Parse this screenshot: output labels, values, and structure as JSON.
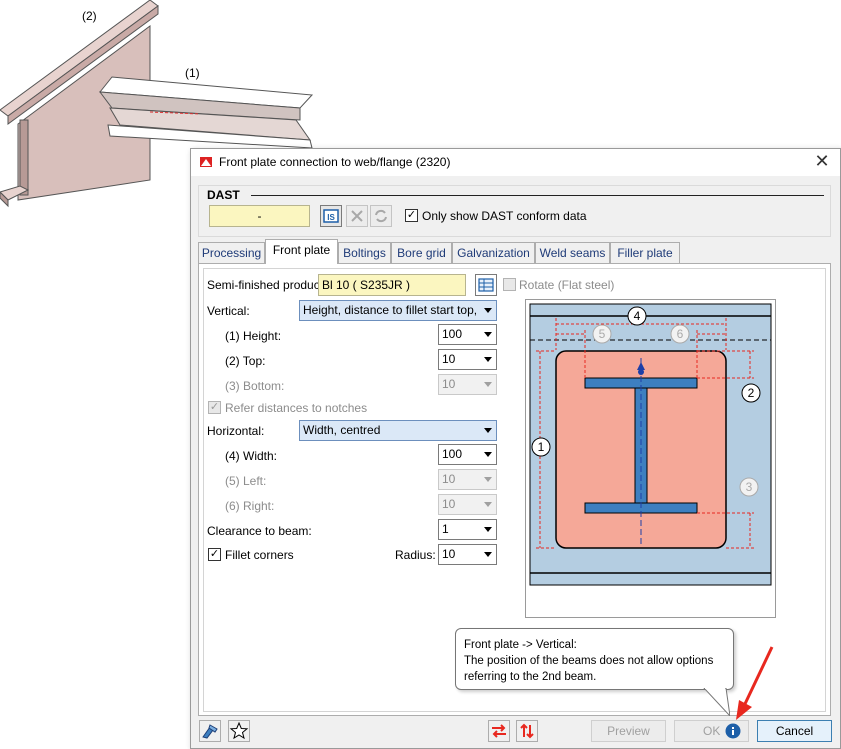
{
  "illustration": {
    "label_beam2": "(2)",
    "label_beam1": "(1)"
  },
  "dialog": {
    "title": "Front plate connection to web/flange (2320)",
    "dast": {
      "group_label": "DAST",
      "field_value": "-",
      "only_conform_label": "Only show DAST conform data",
      "only_conform_checked": true
    },
    "tabs": [
      {
        "label": "Processing",
        "active": false
      },
      {
        "label": "Front plate",
        "active": true
      },
      {
        "label": "Boltings",
        "active": false
      },
      {
        "label": "Bore grid",
        "active": false
      },
      {
        "label": "Galvanization",
        "active": false
      },
      {
        "label": "Weld seams",
        "active": false
      },
      {
        "label": "Filler plate",
        "active": false
      }
    ],
    "form": {
      "semi_finished_label": "Semi-finished produc",
      "semi_finished_value": "Bl 10  ( S235JR )",
      "rotate_label": "Rotate (Flat steel)",
      "vertical_label": "Vertical:",
      "vertical_value": "Height, distance to fillet start top,",
      "height_label": "(1) Height:",
      "height_value": "100",
      "top_label": "(2) Top:",
      "top_value": "10",
      "bottom_label": "(3) Bottom:",
      "bottom_value": "10",
      "refer_notches_label": "Refer distances to notches",
      "horizontal_label": "Horizontal:",
      "horizontal_value": "Width, centred",
      "width_label": "(4) Width:",
      "width_value": "100",
      "left_label": "(5) Left:",
      "left_value": "10",
      "right_label": "(6) Right:",
      "right_value": "10",
      "clearance_label": "Clearance to beam:",
      "clearance_value": "1",
      "fillet_label": "Fillet corners",
      "fillet_checked": true,
      "radius_label": "Radius:",
      "radius_value": "10"
    },
    "diagram_labels": [
      "4",
      "5",
      "6",
      "2",
      "1",
      "3"
    ],
    "tooltip": {
      "line1": "Front plate -> Vertical:",
      "line2": "The position of the beams does not allow options",
      "line3": "referring to the 2nd beam."
    },
    "buttons": {
      "preview": "Preview",
      "ok": "OK",
      "cancel": "Cancel"
    },
    "colors": {
      "plate_fill": "#f5a898",
      "background_fill": "#b4cde1",
      "profile_fill": "#3d7fc0",
      "dimension_red": "#e8281f",
      "field_yellow": "#fbf6c0"
    }
  }
}
